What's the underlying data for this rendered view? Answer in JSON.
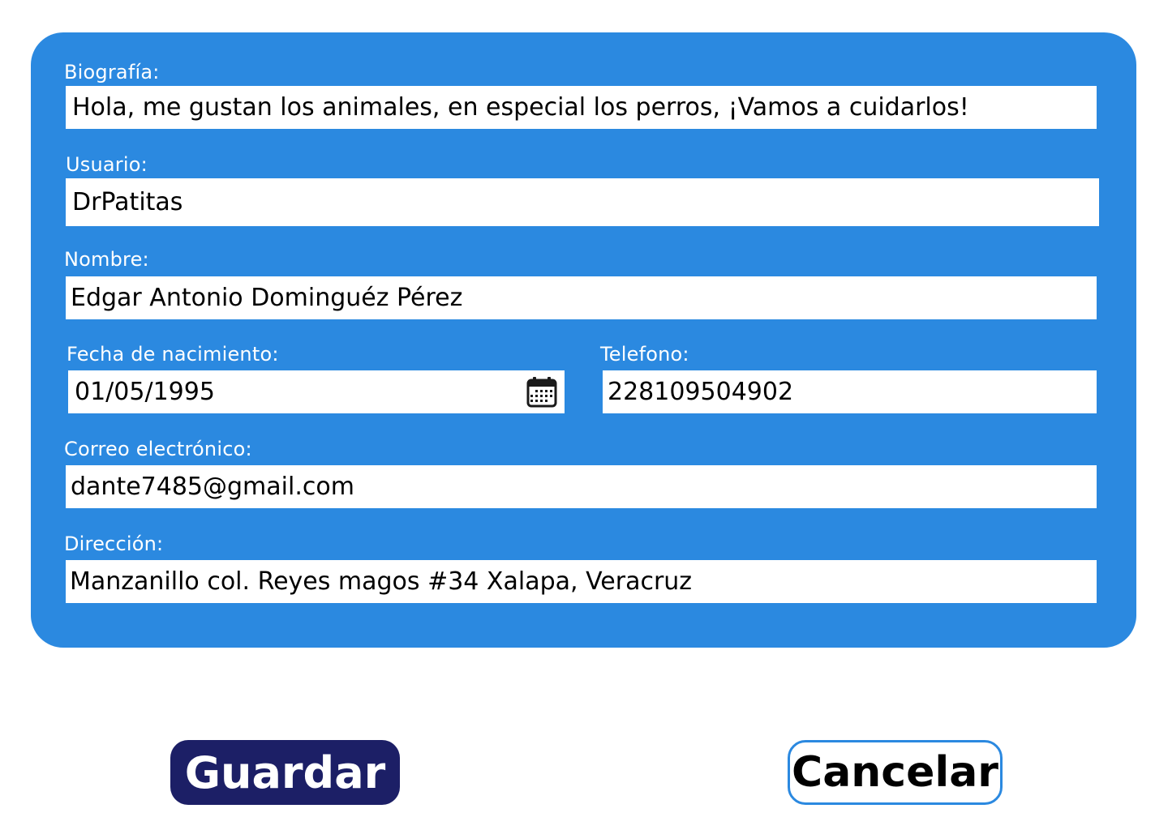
{
  "form": {
    "bio": {
      "label": "Biografía:",
      "value": "Hola, me gustan los animales, en especial los perros, ¡Vamos a cuidarlos!"
    },
    "user": {
      "label": "Usuario:",
      "value": "DrPatitas"
    },
    "name": {
      "label": "Nombre:",
      "value": "Edgar Antonio Dominguéz Pérez"
    },
    "birthdate": {
      "label": "Fecha de nacimiento:",
      "value": "01/05/1995",
      "icon": "calendar-icon"
    },
    "phone": {
      "label": "Telefono:",
      "value": "228109504902"
    },
    "email": {
      "label": "Correo electrónico:",
      "value": "dante7485@gmail.com"
    },
    "address": {
      "label": "Dirección:",
      "value": "Manzanillo col. Reyes magos #34 Xalapa, Veracruz"
    }
  },
  "actions": {
    "save_label": "Guardar",
    "cancel_label": "Cancelar"
  },
  "colors": {
    "panel": "#2b89e0",
    "save_button": "#1c1f66",
    "cancel_border": "#2b89e0"
  }
}
